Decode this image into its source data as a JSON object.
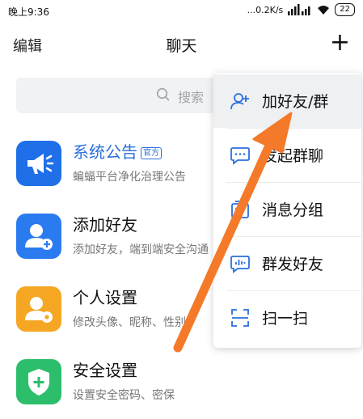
{
  "status_bar": {
    "time": "晚上9:36",
    "net_speed": "...0.2K/s",
    "battery": "22"
  },
  "header": {
    "edit_label": "编辑",
    "title": "聊天",
    "add_label": "+"
  },
  "search": {
    "placeholder": "搜索"
  },
  "chat_list": [
    {
      "name": "系统公告",
      "badge": "官方",
      "subtitle": "蝙蝠平台净化治理公告",
      "color": "#1f6fe8",
      "icon": "megaphone-icon"
    },
    {
      "name": "添加好友",
      "subtitle": "添加好友，端到端安全沟通",
      "color": "#2b7bf0",
      "icon": "add-user-icon"
    },
    {
      "name": "个人设置",
      "subtitle": "修改头像、昵称、性别",
      "color": "#f5a623",
      "icon": "user-settings-icon"
    },
    {
      "name": "安全设置",
      "subtitle": "设置安全密码、密保",
      "color": "#2dbe6c",
      "icon": "shield-plus-icon"
    }
  ],
  "menu": [
    {
      "label": "加好友/群",
      "icon": "add-friend-icon"
    },
    {
      "label": "发起群聊",
      "icon": "chat-bubble-icon"
    },
    {
      "label": "消息分组",
      "icon": "message-group-icon"
    },
    {
      "label": "群发好友",
      "icon": "broadcast-icon"
    },
    {
      "label": "扫一扫",
      "icon": "scan-icon"
    }
  ],
  "colors": {
    "accent": "#2b6fde",
    "arrow": "#f47a2a"
  }
}
